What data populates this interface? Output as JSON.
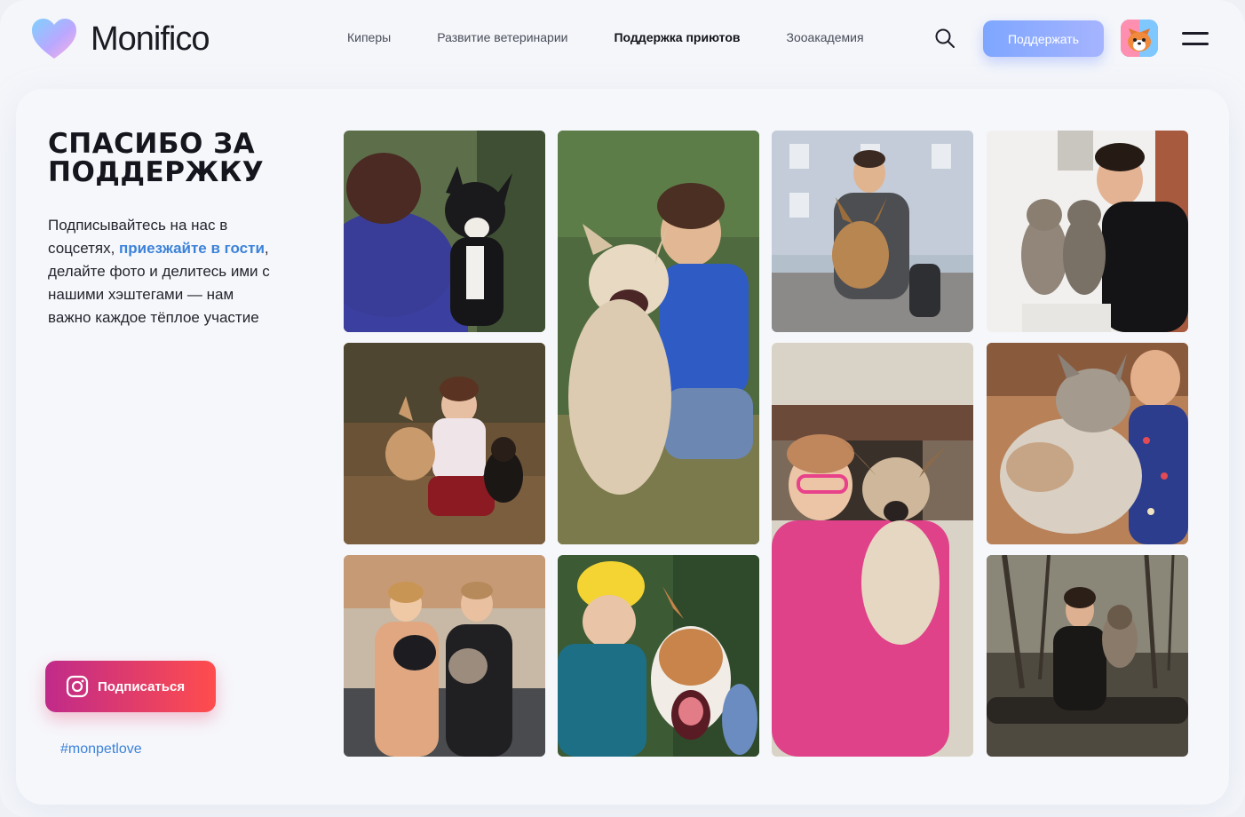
{
  "brand": {
    "name": "Monifico"
  },
  "nav": {
    "items": [
      {
        "label": "Киперы"
      },
      {
        "label": "Развитие ветеринарии"
      },
      {
        "label": "Поддержка приютов"
      },
      {
        "label": "Зооакадемия"
      }
    ]
  },
  "header": {
    "support_label": "Поддержать"
  },
  "section": {
    "title_line1": "СПАСИБО ЗА",
    "title_line2": "ПОДДЕРЖКУ",
    "desc_before": "Подписывайтесь на нас в соцсетях, ",
    "desc_link": "приезжайте в гости",
    "desc_after": ", делайте фото и делитесь ими с нашими хэштегами — нам важно каждое тёплое участие",
    "subscribe_label": "Подписаться",
    "hashtag": "#monpetlove"
  },
  "colors": {
    "accent_blue": "#3b82d9",
    "support_button": "#8aa8ff",
    "subscribe_gradient_start": "#c02a8a",
    "subscribe_gradient_end": "#ff4d4d"
  }
}
